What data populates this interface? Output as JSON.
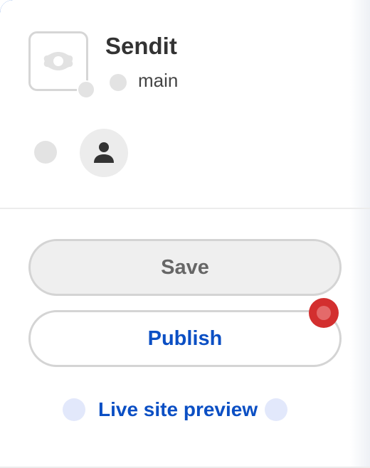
{
  "app": {
    "name": "Sendit",
    "logo_icon": "app-logo-icon",
    "branch": "main"
  },
  "user": {
    "avatar_icon": "person-icon"
  },
  "actions": {
    "save_label": "Save",
    "publish_label": "Publish",
    "live_preview_label": "Live site preview"
  },
  "colors": {
    "accent": "#0b4fc4",
    "badge": "#d32f2f",
    "button_border": "#d4d4d4"
  }
}
